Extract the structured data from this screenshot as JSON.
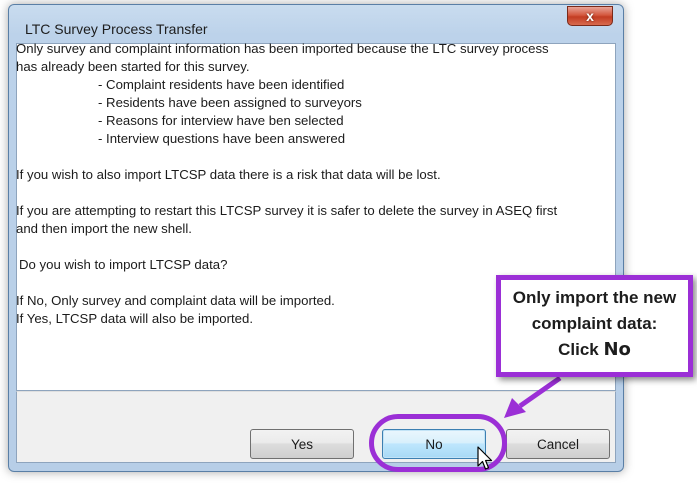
{
  "window": {
    "title": "LTC Survey Process Transfer",
    "close_label": "x"
  },
  "message": {
    "intro": "Only survey and complaint information has been imported because the LTC survey process has already been started for this survey.",
    "bullets": [
      "- Complaint residents have been identified",
      "- Residents have been assigned to surveyors",
      "- Reasons for interview have ben selected",
      "- Interview questions have been answered"
    ],
    "risk": "If you wish to also import LTCSP data there is a risk that data will be lost.",
    "restart": "If you are attempting to restart this LTCSP survey it is safer to delete the survey in ASEQ first and then import the new shell.",
    "question": "Do you wish to import LTCSP data?",
    "if_no": "If No,  Only survey and complaint data will be imported.",
    "if_yes": "If Yes, LTCSP data will also be imported."
  },
  "buttons": {
    "yes": "Yes",
    "no": "No",
    "cancel": "Cancel"
  },
  "annotation": {
    "line1": "Only import the new",
    "line2": "complaint data:",
    "line3_prefix": "Click ",
    "line3_emph": "No"
  },
  "colors": {
    "annotation_accent": "#9b2fd6",
    "close_button": "#c9452c",
    "default_button_border": "#3c7fb1"
  }
}
